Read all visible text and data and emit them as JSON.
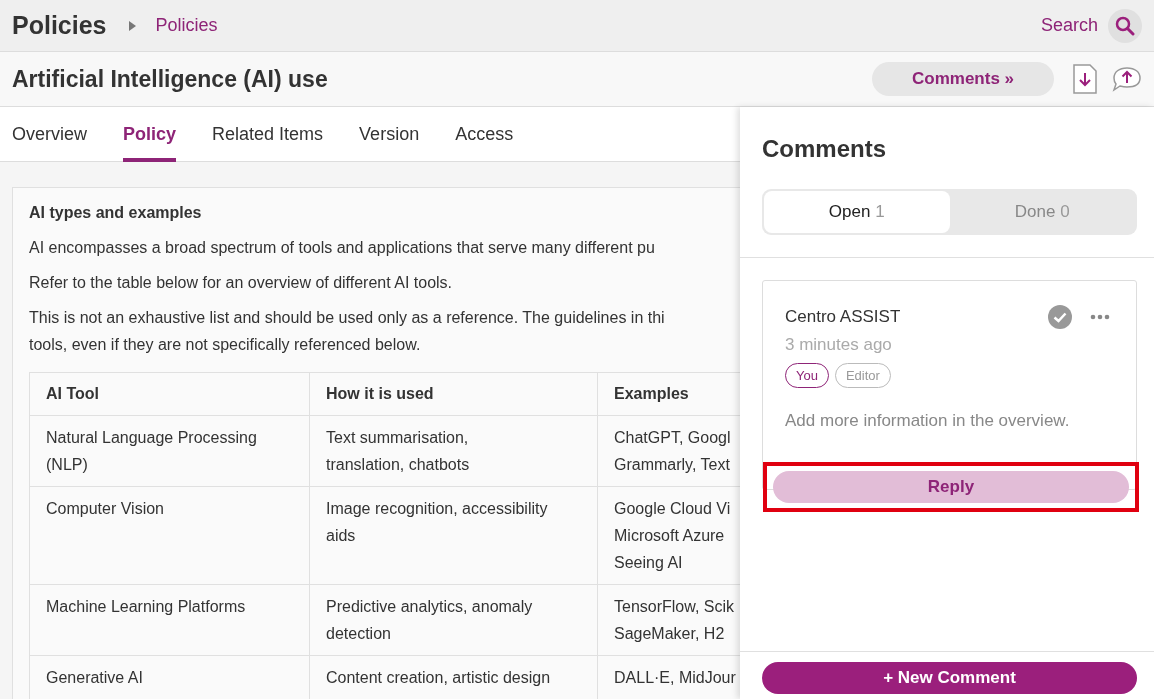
{
  "header": {
    "title": "Policies",
    "breadcrumb": "Policies",
    "search_label": "Search"
  },
  "document": {
    "title": "Artificial Intelligence (AI) use",
    "comments_button": "Comments »"
  },
  "tabs": [
    {
      "label": "Overview",
      "selected": false
    },
    {
      "label": "Policy",
      "selected": true
    },
    {
      "label": "Related Items",
      "selected": false
    },
    {
      "label": "Version",
      "selected": false
    },
    {
      "label": "Access",
      "selected": false
    }
  ],
  "content": {
    "heading": "AI types and examples",
    "paragraphs": [
      "AI encompasses a broad spectrum of tools and applications that serve many different pu",
      "Refer to the table below for an overview of different AI tools.",
      "This is not an exhaustive list and should be used only as a reference. The guidelines in thi\ntools, even if they are not specifically referenced below."
    ],
    "table": {
      "columns": [
        "AI Tool",
        "How it is used",
        "Examples"
      ],
      "rows": [
        [
          "Natural Language Processing\n(NLP)",
          "Text summarisation,\ntranslation, chatbots",
          "ChatGPT, Googl\nGrammarly, Text"
        ],
        [
          "Computer Vision",
          "Image recognition, accessibility\naids",
          "Google Cloud Vi\nMicrosoft Azure\nSeeing AI"
        ],
        [
          "Machine Learning Platforms",
          "Predictive analytics, anomaly\ndetection",
          "TensorFlow, Scik\nSageMaker, H2"
        ],
        [
          "Generative AI",
          "Content creation, artistic design",
          "DALL·E, MidJour"
        ]
      ]
    }
  },
  "comments_panel": {
    "title": "Comments",
    "filters": [
      {
        "label": "Open",
        "count": "1",
        "selected": true
      },
      {
        "label": "Done",
        "count": "0",
        "selected": false
      }
    ],
    "comments": [
      {
        "author": "Centro ASSIST",
        "time": "3 minutes ago",
        "tags": [
          "You",
          "Editor"
        ],
        "text": "Add more information in the overview.",
        "resolved": false,
        "reply_label": "Reply"
      }
    ],
    "new_comment": "+ New Comment"
  }
}
